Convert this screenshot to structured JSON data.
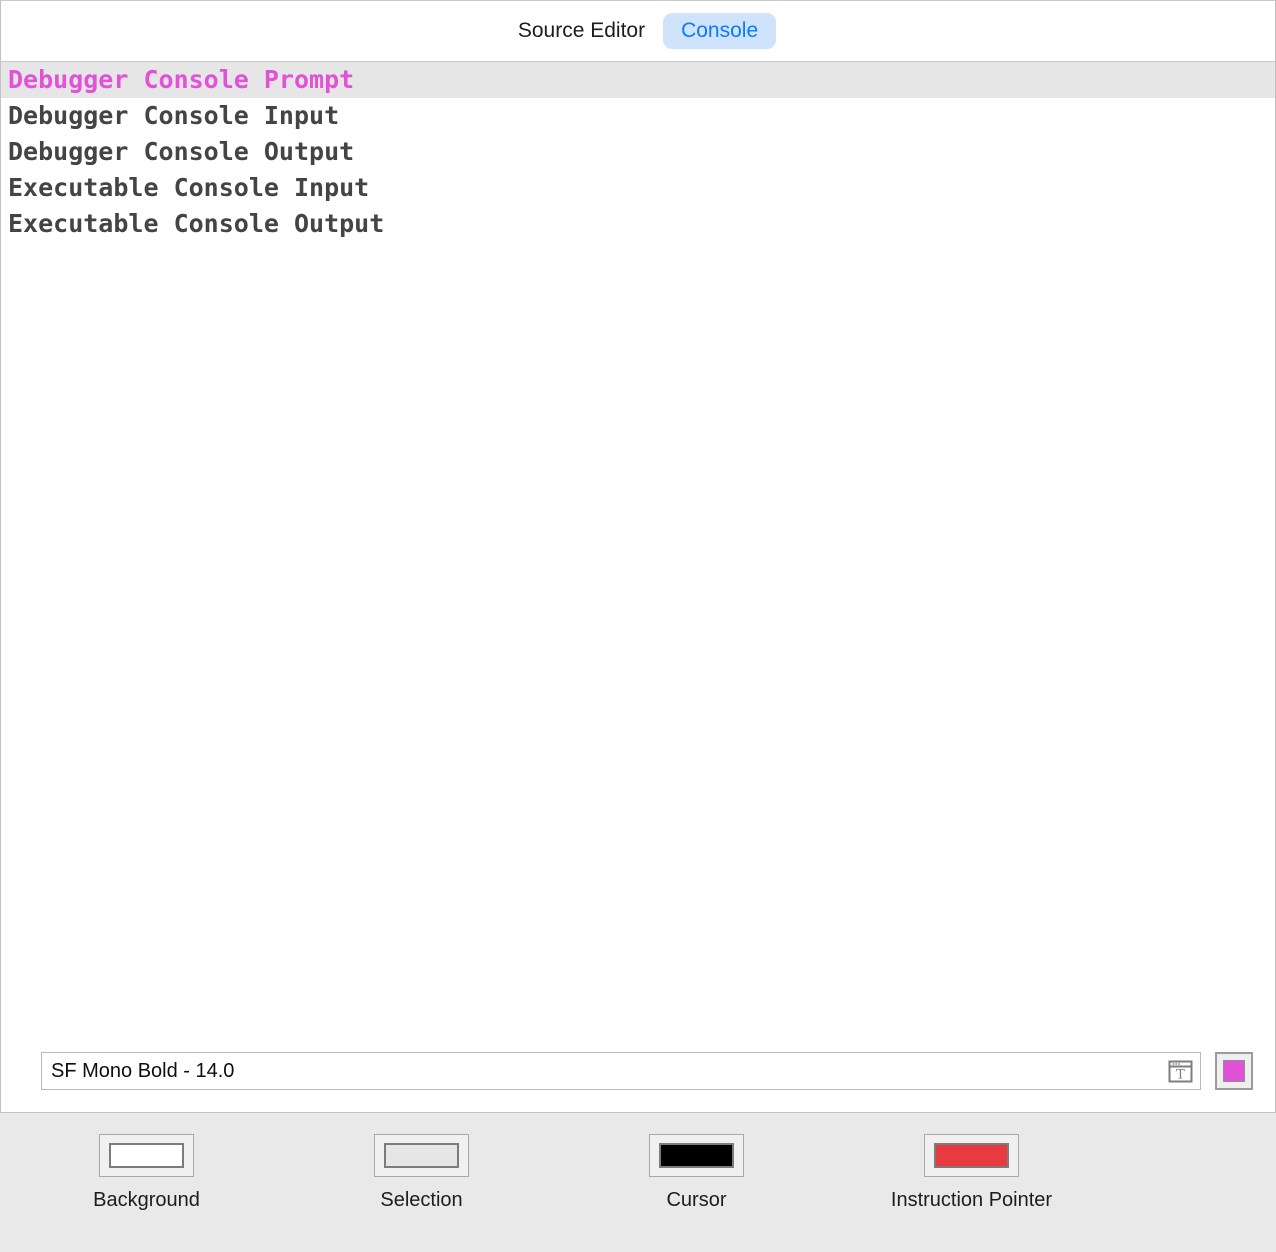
{
  "tabs": [
    {
      "label": "Source Editor",
      "selected": false
    },
    {
      "label": "Console",
      "selected": true
    }
  ],
  "style_rows": [
    {
      "label": "Debugger Console Prompt",
      "color": "#e152d8",
      "selected": true
    },
    {
      "label": "Debugger Console Input",
      "color": "#444444",
      "selected": false
    },
    {
      "label": "Debugger Console Output",
      "color": "#444444",
      "selected": false
    },
    {
      "label": "Executable Console Input",
      "color": "#444444",
      "selected": false
    },
    {
      "label": "Executable Console Output",
      "color": "#444444",
      "selected": false
    }
  ],
  "font_control": {
    "value": "SF Mono Bold - 14.0",
    "panel_icon": "font-panel-icon",
    "text_color_swatch": "#e152d8"
  },
  "color_swatches": [
    {
      "label": "Background",
      "color": "#ffffff"
    },
    {
      "label": "Selection",
      "color": "#e6e6e6"
    },
    {
      "label": "Cursor",
      "color": "#000000"
    },
    {
      "label": "Instruction Pointer",
      "color": "#e83b41"
    }
  ],
  "theme": {
    "tab_selected_bg": "#cfe4fc",
    "tab_selected_fg": "#0a7aff",
    "selected_row_bg": "#e6e6e6",
    "bottom_bar_bg": "#e9e9e9",
    "panel_border": "#c3c3c3"
  }
}
